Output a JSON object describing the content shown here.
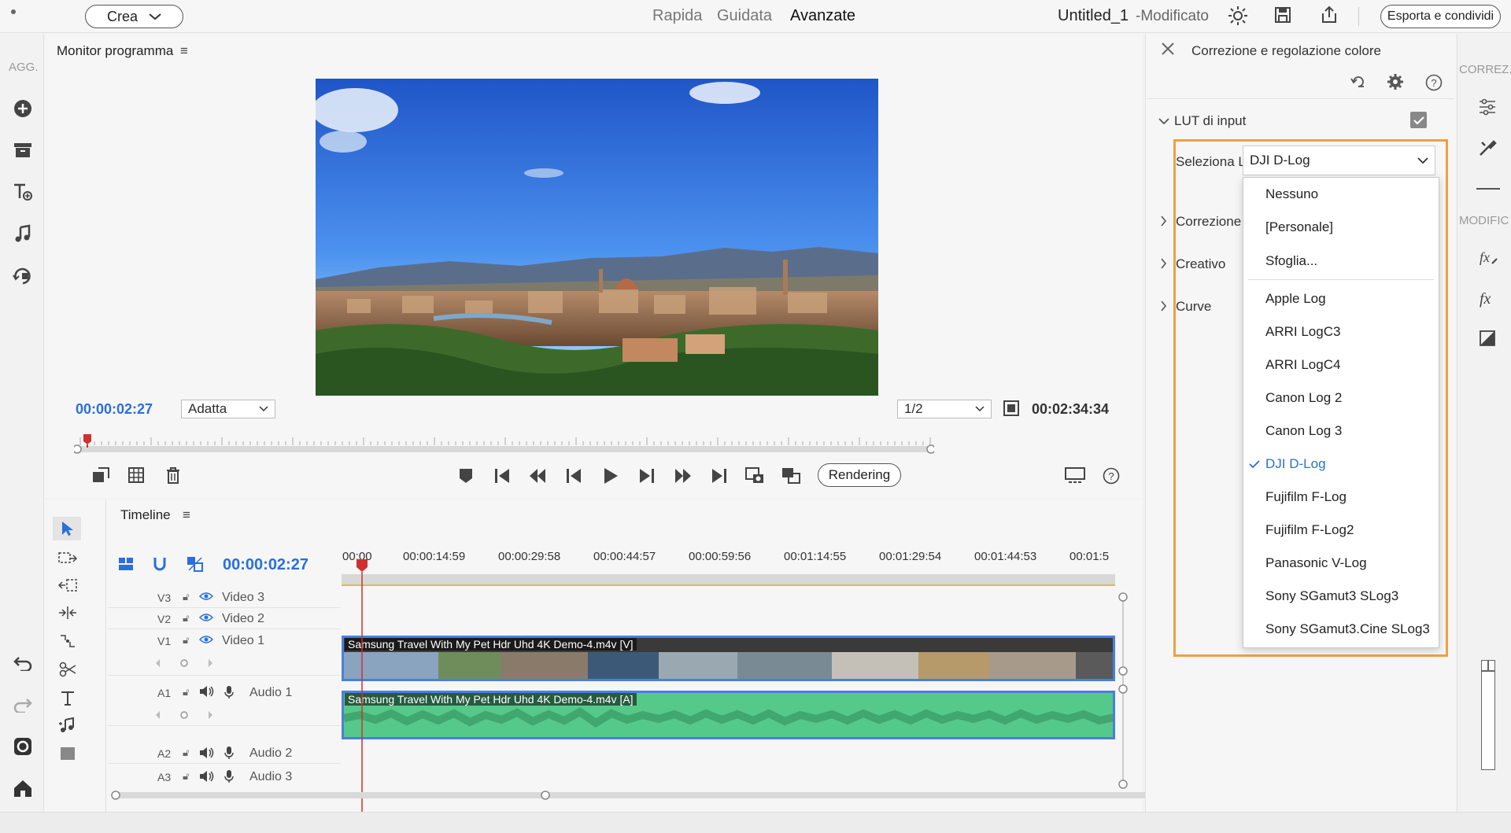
{
  "topbar": {
    "create_label": "Crea",
    "modes": [
      "Rapida",
      "Guidata",
      "Avanzate"
    ],
    "project_title": "Untitled_1",
    "project_status": "-Modificato",
    "export_label": "Esporta e condividi"
  },
  "left_rail": {
    "header": "AGG."
  },
  "monitor": {
    "title": "Monitor programma",
    "current_timecode": "00:00:02:27",
    "fit_value": "Adatta",
    "resolution_value": "1/2",
    "duration_timecode": "00:02:34:34",
    "render_label": "Rendering"
  },
  "timeline": {
    "title": "Timeline",
    "timecode": "00:00:02:27",
    "ruler": [
      "00:00",
      "00:00:14:59",
      "00:00:29:58",
      "00:00:44:57",
      "00:00:59:56",
      "00:01:14:55",
      "00:01:29:54",
      "00:01:44:53",
      "00:01:5"
    ],
    "tracks": [
      {
        "id": "V3",
        "name": "Video 3"
      },
      {
        "id": "V2",
        "name": "Video 2"
      },
      {
        "id": "V1",
        "name": "Video 1"
      },
      {
        "id": "A1",
        "name": "Audio 1"
      },
      {
        "id": "A2",
        "name": "Audio 2"
      },
      {
        "id": "A3",
        "name": "Audio 3"
      }
    ],
    "video_clip_label": "Samsung Travel With My Pet Hdr Uhd 4K Demo-4.m4v [V]",
    "audio_clip_label": "Samsung Travel With My Pet Hdr Uhd 4K Demo-4.m4v [A]"
  },
  "right_panel": {
    "title": "Correzione e regolazione colore",
    "lut_section": "LUT di input",
    "select_label": "Seleziona L",
    "selected_lut": "DJI D-Log",
    "sections": [
      "Correzione",
      "Creativo",
      "Curve"
    ],
    "dropdown_options": [
      "Nessuno",
      "[Personale]",
      "Sfoglia...",
      "Apple Log",
      "ARRI LogC3",
      "ARRI LogC4",
      "Canon Log 2",
      "Canon Log 3",
      "DJI D-Log",
      "Fujifilm F-Log",
      "Fujifilm F-Log2",
      "Panasonic V-Log",
      "Sony SGamut3 SLog3",
      "Sony SGamut3.Cine SLog3"
    ]
  },
  "right_rail": {
    "header_top": "CORREZ.",
    "header_mid": "MODIFIC"
  },
  "colors": {
    "accent_blue": "#2a6fdb",
    "highlight_orange": "#f0a040",
    "playhead_red": "#d03030",
    "audio_green": "#55c98a",
    "clip_blue_border": "#4a7fe0"
  }
}
